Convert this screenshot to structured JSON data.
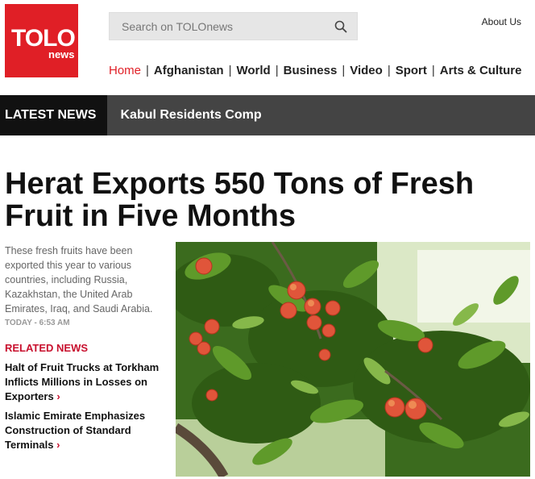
{
  "logo": {
    "brand": "TOLO",
    "sub": "news",
    "color": "#e01f26"
  },
  "search": {
    "placeholder": "Search on TOLOnews"
  },
  "about_link": "About Us",
  "nav": {
    "items": [
      {
        "label": "Home",
        "active": true
      },
      {
        "label": "Afghanistan"
      },
      {
        "label": "World"
      },
      {
        "label": "Business"
      },
      {
        "label": "Video"
      },
      {
        "label": "Sport"
      },
      {
        "label": "Arts & Culture"
      }
    ],
    "separator": "|"
  },
  "latest_news": {
    "label": "LATEST NEWS",
    "ticker": "Kabul Residents Comp"
  },
  "article": {
    "headline": "Herat Exports 550 Tons of Fresh Fruit in Five Months",
    "summary": "These fresh fruits have been exported this year to various countries, including Russia, Kazakhstan, the United Arab Emirates, Iraq, and Saudi Arabia.",
    "timestamp": "TODAY - 6:53 AM",
    "image_alt": "peach-tree-photo"
  },
  "related": {
    "title": "RELATED NEWS",
    "items": [
      {
        "title": "Halt of Fruit Trucks at Torkham Inflicts Millions in Losses on Exporters"
      },
      {
        "title": "Islamic Emirate Emphasizes Construction of Standard Terminals"
      }
    ],
    "chevron": "›"
  },
  "colors": {
    "accent": "#e01f26",
    "related": "#c8102e",
    "latest_bar": "#444444",
    "latest_label_bg": "#111111"
  }
}
